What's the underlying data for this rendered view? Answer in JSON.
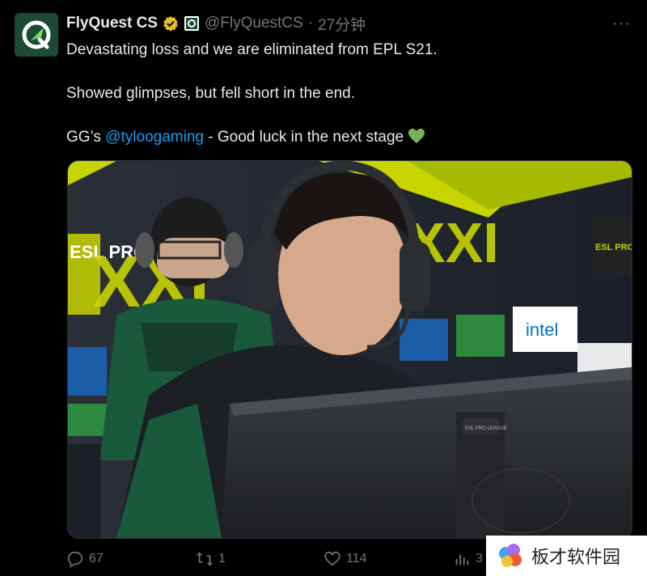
{
  "author": {
    "display_name": "FlyQuest CS",
    "handle": "@FlyQuestCS",
    "separator": "·",
    "time": "27分钟"
  },
  "more_label": "···",
  "tweet": {
    "line1": "Devastating loss and we are eliminated from EPL S21.",
    "line2": "Showed glimpses, but fell short in the end.",
    "line3_prefix": "GG’s ",
    "line3_mention": "@tyloogaming",
    "line3_suffix": " - Good luck in the next stage "
  },
  "media": {
    "banner_text_left": "ESL PRO LEAGUE",
    "banner_text_right": "ESL PRO LEAGUE",
    "banner_number": "XXI",
    "sponsor_intel": "intel",
    "monitor_label": "ESL PRO LEAGUE"
  },
  "actions": {
    "replies": "67",
    "reposts": "1",
    "likes": "114",
    "views": "3"
  },
  "watermark": {
    "text": "板才软件园"
  },
  "colors": {
    "background": "#000000",
    "text": "#e7e9ea",
    "muted": "#71767b",
    "link": "#1d9bf0",
    "brand_green": "#1d4a35",
    "esl_yellow": "#c8d400"
  }
}
